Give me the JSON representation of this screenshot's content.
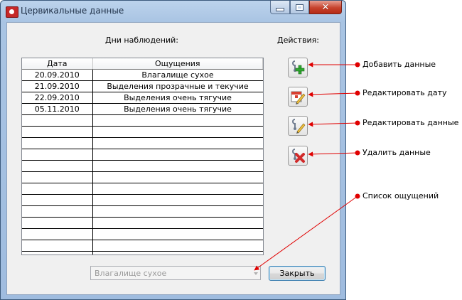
{
  "window": {
    "title": "Цервикальные данные"
  },
  "labels": {
    "days": "Дни наблюдений:",
    "actions": "Действия:"
  },
  "table": {
    "columns": [
      "Дата",
      "Ощущения"
    ],
    "rows": [
      [
        "20.09.2010",
        "Влагалище сухое"
      ],
      [
        "21.09.2010",
        "Выделения прозрачные и текучие"
      ],
      [
        "22.09.2010",
        "Выделения очень тягучие"
      ],
      [
        "05.11.2010",
        "Выделения очень тягучие"
      ],
      [
        "",
        ""
      ],
      [
        "",
        ""
      ],
      [
        "",
        ""
      ],
      [
        "",
        ""
      ],
      [
        "",
        ""
      ],
      [
        "",
        ""
      ],
      [
        "",
        ""
      ],
      [
        "",
        ""
      ],
      [
        "",
        ""
      ],
      [
        "",
        ""
      ],
      [
        "",
        ""
      ],
      [
        "",
        ""
      ],
      [
        "",
        ""
      ]
    ]
  },
  "combo": {
    "value": "Влагалище сухое"
  },
  "buttons": {
    "close": "Закрыть"
  },
  "annotations": {
    "add": "Добавить данные",
    "edit_date": "Редактировать дату",
    "edit_data": "Редактировать данные",
    "delete": "Удалить данные",
    "list": "Список ощущений"
  },
  "colors": {
    "annotation_line": "#e00000",
    "accent_border": "#3c7fb1"
  }
}
